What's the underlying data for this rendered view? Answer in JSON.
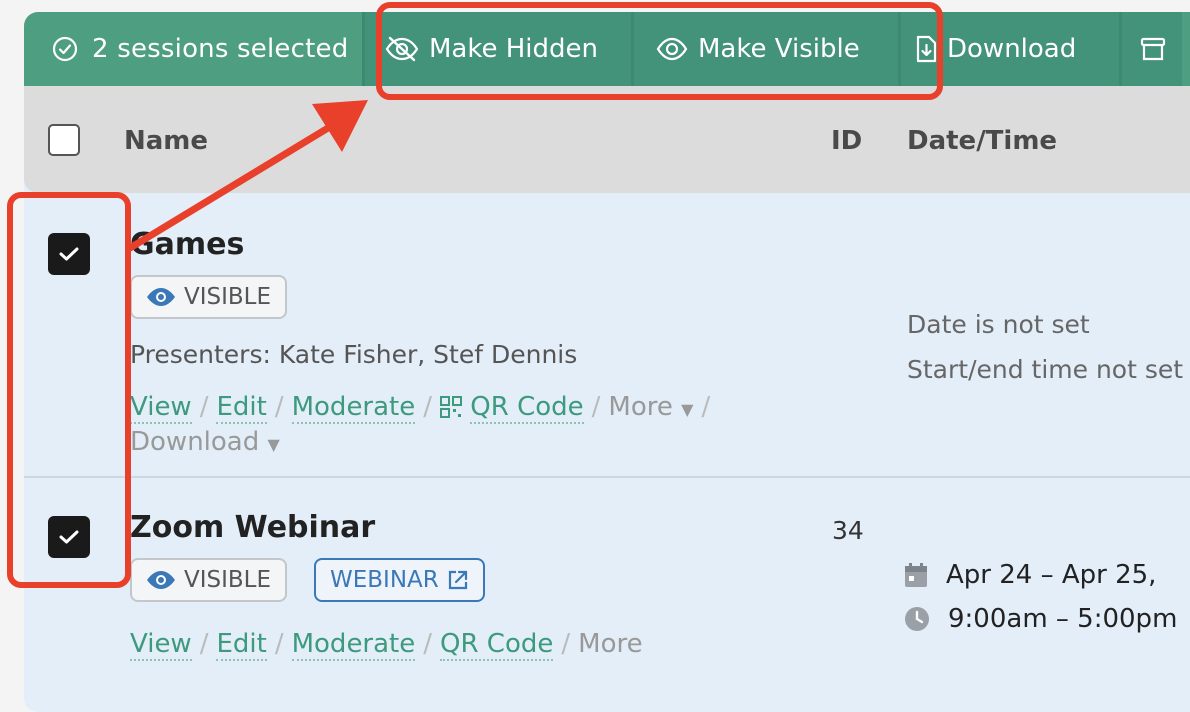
{
  "bulk_bar": {
    "selected_text": "2 sessions selected",
    "make_hidden": "Make Hidden",
    "make_visible": "Make Visible",
    "download": "Download"
  },
  "table": {
    "columns": {
      "name": "Name",
      "id": "ID",
      "date_time": "Date/Time"
    }
  },
  "rows": [
    {
      "title": "Games",
      "visibility": "VISIBLE",
      "presenters": "Presenters: Kate Fisher, Stef Dennis",
      "links": {
        "view": "View",
        "edit": "Edit",
        "moderate": "Moderate",
        "qr": "QR Code",
        "more": "More",
        "download": "Download"
      },
      "date_line1": "Date is not set",
      "date_line2": "Start/end time not set"
    },
    {
      "title": "Zoom Webinar",
      "id": "34",
      "visibility": "VISIBLE",
      "type_badge": "WEBINAR",
      "links": {
        "view": "View",
        "edit": "Edit",
        "moderate": "Moderate",
        "qr": "QR Code",
        "more": "More"
      },
      "date_range": "Apr 24 – Apr 25,",
      "time_range": "9:00am – 5:00pm"
    }
  ],
  "colors": {
    "bulk_bar": "#4e9e82",
    "action_button": "#43927a",
    "link": "#3d9a7d",
    "annotation": "#e8402a",
    "webinar_badge": "#3a78b8"
  }
}
